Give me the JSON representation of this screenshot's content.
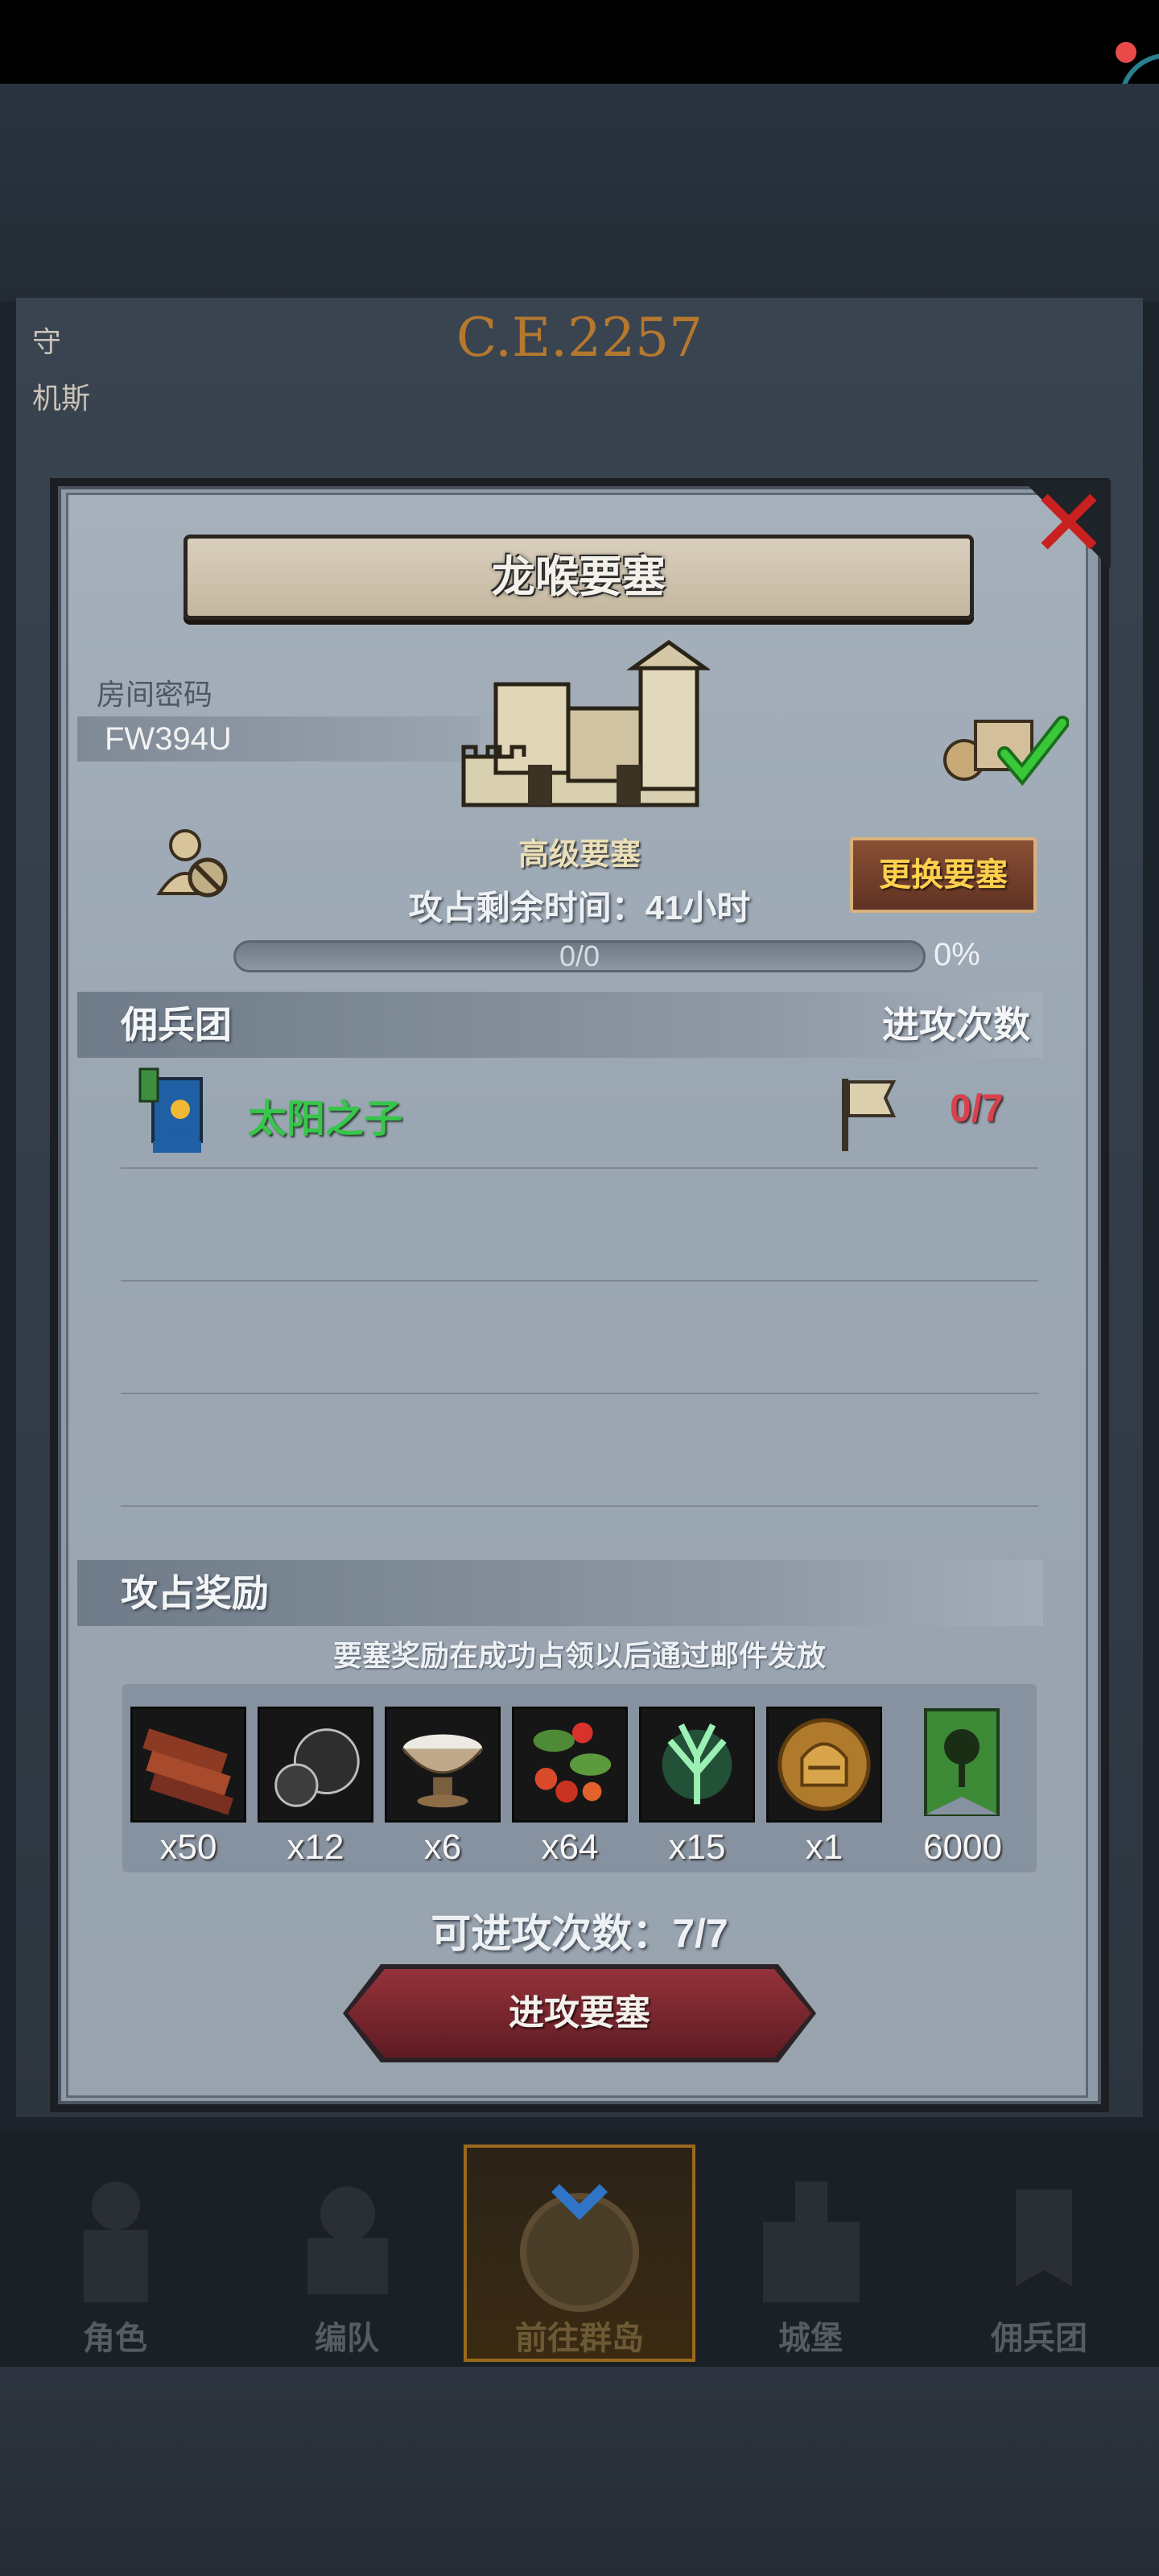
{
  "header": {
    "year": "C.E.2257"
  },
  "background": {
    "left_text_1": "守",
    "left_text_2": "机斯"
  },
  "dialog": {
    "title": "龙喉要塞",
    "close_icon": "close-x-icon",
    "room": {
      "label": "房间密码",
      "code": "FW394U"
    },
    "fortress": {
      "level": "高级要塞",
      "change_button": "更换要塞"
    },
    "remaining_time": "攻占剩余时间：41小时",
    "progress": {
      "text": "0/0",
      "percent": "0%",
      "fill": 0
    },
    "mercenary_section": {
      "label": "佣兵团",
      "attacks_label": "进攻次数"
    },
    "teams": [
      {
        "name": "太阳之子",
        "attacks": "0/7"
      }
    ],
    "rewards_section": {
      "label": "攻占奖励",
      "note": "要塞奖励在成功占领以后通过邮件发放",
      "items": [
        {
          "icon": "wood-logs-icon",
          "qty": "x50"
        },
        {
          "icon": "truffle-icon",
          "qty": "x12"
        },
        {
          "icon": "milk-bowl-icon",
          "qty": "x6"
        },
        {
          "icon": "berries-icon",
          "qty": "x64"
        },
        {
          "icon": "green-herb-icon",
          "qty": "x15"
        },
        {
          "icon": "knight-helmet-coin-icon",
          "qty": "x1"
        },
        {
          "icon": "tree-banner-icon",
          "qty": "6000"
        }
      ]
    },
    "available_attacks": "可进攻次数：7/7",
    "attack_button": "进攻要塞"
  },
  "nav": {
    "tabs": [
      {
        "label": "角色",
        "active": false
      },
      {
        "label": "编队",
        "active": false
      },
      {
        "label": "前往群岛",
        "active": true
      },
      {
        "label": "城堡",
        "active": false
      },
      {
        "label": "佣兵团",
        "active": false
      }
    ]
  },
  "colors": {
    "team_name": "#37c64b",
    "attack_count": "#d8424c",
    "change_button_text": "#ffd04e",
    "close_x": "#c8211f"
  }
}
